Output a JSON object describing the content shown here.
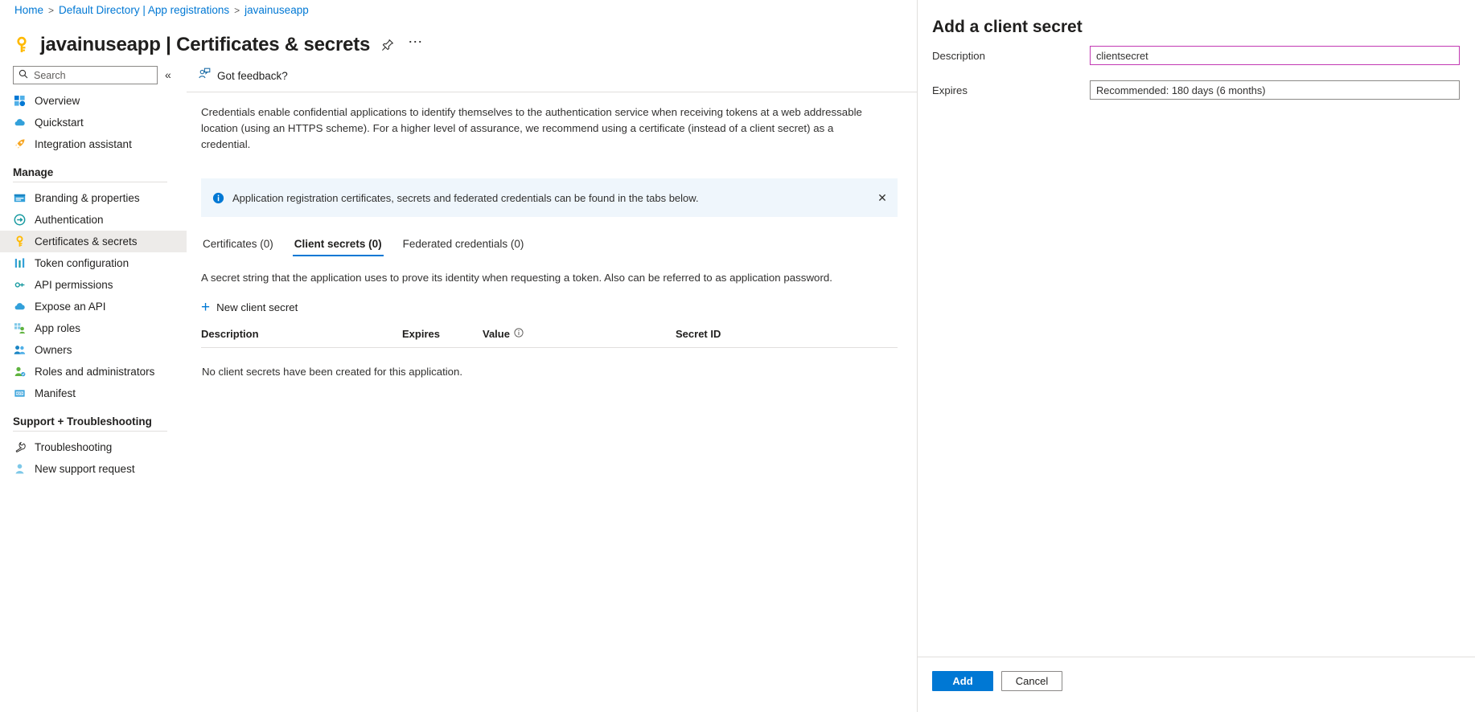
{
  "breadcrumb": {
    "items": [
      {
        "label": "Home"
      },
      {
        "label": "Default Directory | App registrations"
      },
      {
        "label": "javainuseapp"
      }
    ],
    "separator": ">"
  },
  "header": {
    "icon": "key-icon",
    "title": "javainuseapp | Certificates & secrets",
    "pin_icon": "pin-icon",
    "more_icon": "ellipsis-icon"
  },
  "sidebar": {
    "search": {
      "placeholder": "Search",
      "value": "",
      "icon": "search-icon"
    },
    "collapse_icon": "chevron-double-left-icon",
    "items": [
      {
        "label": "Overview",
        "icon": "overview-icon",
        "active": false
      },
      {
        "label": "Quickstart",
        "icon": "quickstart-cloud-icon",
        "active": false
      },
      {
        "label": "Integration assistant",
        "icon": "rocket-icon",
        "active": false
      }
    ],
    "groups": [
      {
        "title": "Manage",
        "items": [
          {
            "label": "Branding & properties",
            "icon": "branding-icon",
            "active": false
          },
          {
            "label": "Authentication",
            "icon": "authentication-icon",
            "active": false
          },
          {
            "label": "Certificates & secrets",
            "icon": "key-icon",
            "active": true
          },
          {
            "label": "Token configuration",
            "icon": "token-configuration-icon",
            "active": false
          },
          {
            "label": "API permissions",
            "icon": "api-permissions-icon",
            "active": false
          },
          {
            "label": "Expose an API",
            "icon": "expose-api-cloud-icon",
            "active": false
          },
          {
            "label": "App roles",
            "icon": "app-roles-icon",
            "active": false
          },
          {
            "label": "Owners",
            "icon": "owners-icon",
            "active": false
          },
          {
            "label": "Roles and administrators",
            "icon": "roles-administrators-icon",
            "active": false
          },
          {
            "label": "Manifest",
            "icon": "manifest-icon",
            "active": false
          }
        ]
      },
      {
        "title": "Support + Troubleshooting",
        "items": [
          {
            "label": "Troubleshooting",
            "icon": "wrench-icon",
            "active": false
          },
          {
            "label": "New support request",
            "icon": "support-person-icon",
            "active": false
          }
        ]
      }
    ]
  },
  "commandbar": {
    "feedback_label": "Got feedback?",
    "feedback_icon": "feedback-person-icon"
  },
  "main": {
    "intro": "Credentials enable confidential applications to identify themselves to the authentication service when receiving tokens at a web addressable location (using an HTTPS scheme). For a higher level of assurance, we recommend using a certificate (instead of a client secret) as a credential.",
    "infobar": {
      "icon": "info-icon",
      "text": "Application registration certificates, secrets and federated credentials can be found in the tabs below.",
      "close_icon": "close-icon"
    },
    "tabs": [
      {
        "label": "Certificates (0)",
        "active": false
      },
      {
        "label": "Client secrets (0)",
        "active": true
      },
      {
        "label": "Federated credentials (0)",
        "active": false
      }
    ],
    "tab_description": "A secret string that the application uses to prove its identity when requesting a token. Also can be referred to as application password.",
    "new_secret_button": {
      "label": "New client secret",
      "icon": "plus-icon"
    },
    "table": {
      "columns": [
        {
          "label": "Description",
          "info_icon": false
        },
        {
          "label": "Expires",
          "info_icon": false
        },
        {
          "label": "Value",
          "info_icon": true
        },
        {
          "label": "Secret ID",
          "info_icon": false
        }
      ],
      "empty_message": "No client secrets have been created for this application.",
      "rows": []
    }
  },
  "panel": {
    "title": "Add a client secret",
    "fields": [
      {
        "label": "Description",
        "type": "text",
        "value": "clientsecret",
        "placeholder": ""
      },
      {
        "label": "Expires",
        "type": "select",
        "value": "Recommended: 180 days (6 months)"
      }
    ],
    "actions": {
      "primary": "Add",
      "secondary": "Cancel"
    }
  },
  "colors": {
    "accent": "#0078d4",
    "link": "#0078d4",
    "info_bg": "#eff6fc",
    "active_nav_bg": "#edebe9",
    "focus_border": "#c239b3"
  }
}
